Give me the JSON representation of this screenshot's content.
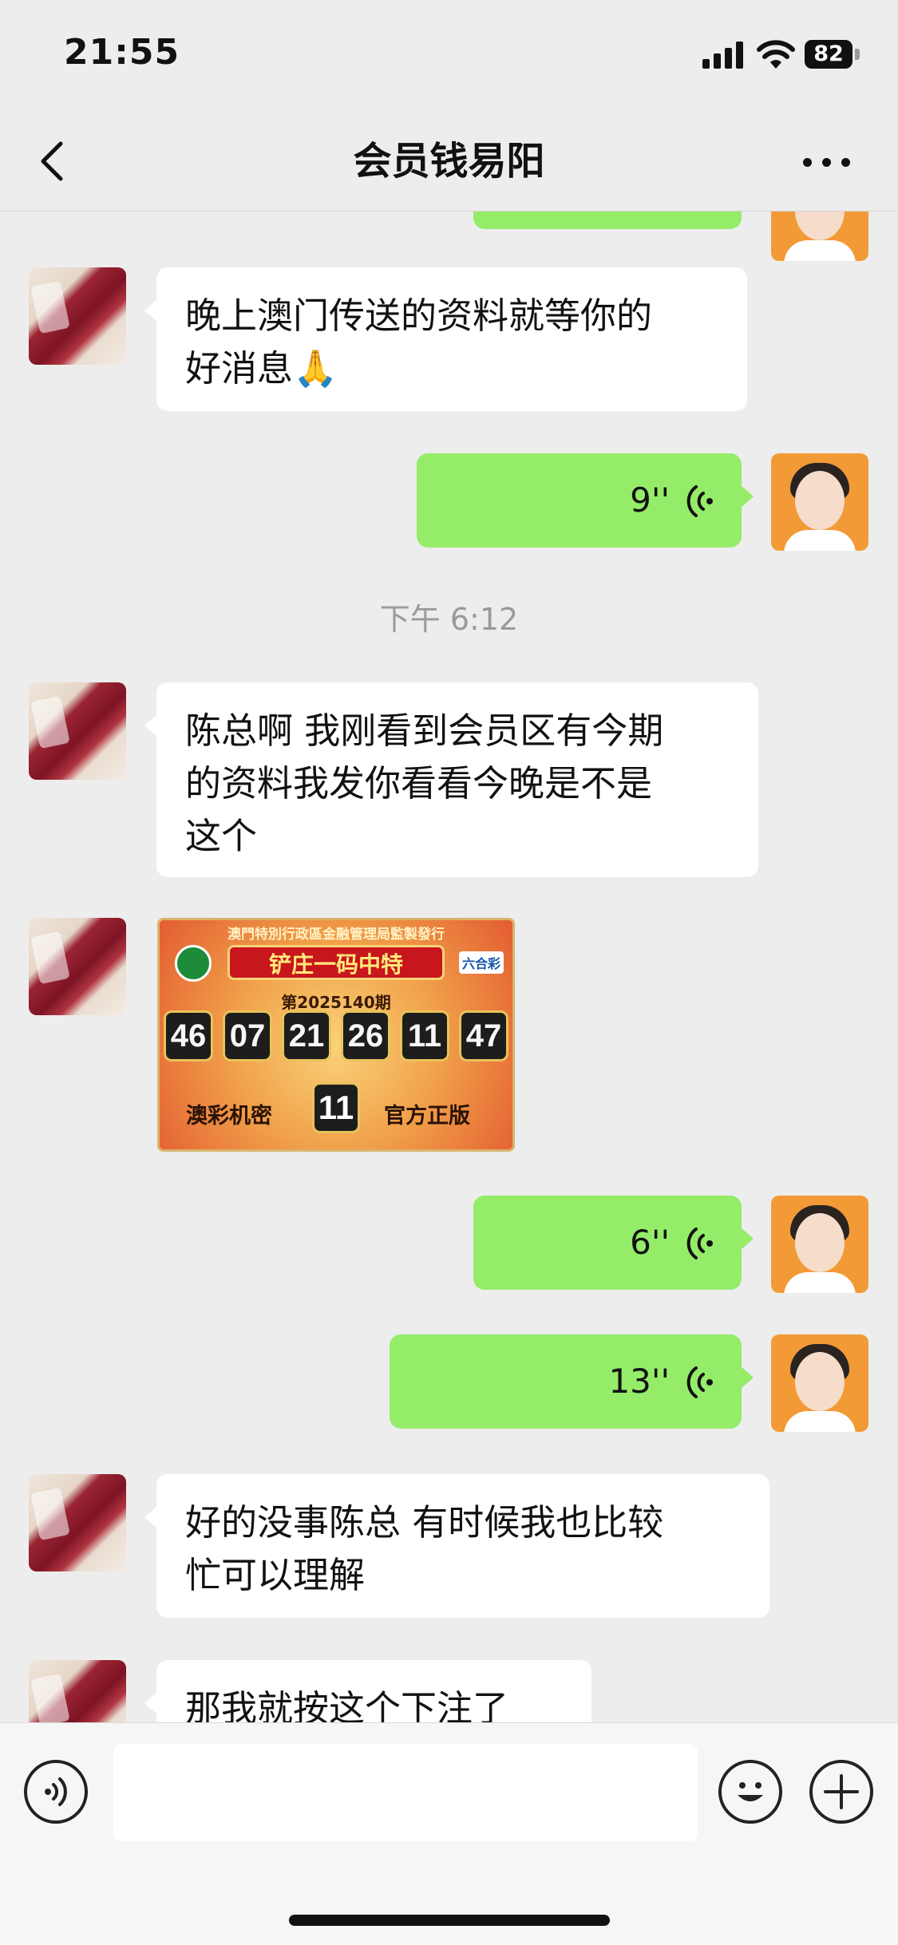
{
  "status_bar": {
    "time": "21:55",
    "battery": "82"
  },
  "nav": {
    "title": "会员钱易阳",
    "back_icon": "chevron-left-icon",
    "more_icon": "more-dots-icon"
  },
  "messages": [
    {
      "id": "m1",
      "from": "peer",
      "type": "text",
      "lines": [
        "晚上澳门传送的资料就等你的",
        "好消息🙏"
      ]
    },
    {
      "id": "m2",
      "from": "self",
      "type": "voice",
      "duration": "9''"
    },
    {
      "id": "sep1",
      "type": "time",
      "text": "下午 6:12"
    },
    {
      "id": "m3",
      "from": "peer",
      "type": "text",
      "lines": [
        "陈总啊 我刚看到会员区有今期",
        "的资料我发你看看今晚是不是",
        "这个"
      ]
    },
    {
      "id": "m4",
      "from": "peer",
      "type": "image",
      "image": {
        "top_text": "澳門特別行政區金融管理局監製發行",
        "banner": "铲庄一码中特",
        "issue": "第2025140期",
        "numbers": [
          "46",
          "07",
          "21",
          "26",
          "11",
          "47"
        ],
        "special": "11",
        "left_label": "澳彩机密",
        "right_label": "官方正版",
        "logo": "六合彩"
      }
    },
    {
      "id": "m5",
      "from": "self",
      "type": "voice",
      "duration": "6''"
    },
    {
      "id": "m6",
      "from": "self",
      "type": "voice",
      "duration": "13''"
    },
    {
      "id": "m7",
      "from": "peer",
      "type": "text",
      "lines": [
        "好的没事陈总  有时候我也比较",
        "忙可以理解"
      ]
    },
    {
      "id": "m8",
      "from": "peer",
      "type": "text",
      "lines": [
        "那我就按这个下注了"
      ]
    }
  ],
  "input_bar": {
    "voice_icon": "voice-input-icon",
    "emoji_icon": "emoji-icon",
    "plus_icon": "plus-icon",
    "value": ""
  },
  "colors": {
    "self_bubble": "#95ec69",
    "peer_bubble": "#ffffff",
    "background": "#ededed"
  }
}
